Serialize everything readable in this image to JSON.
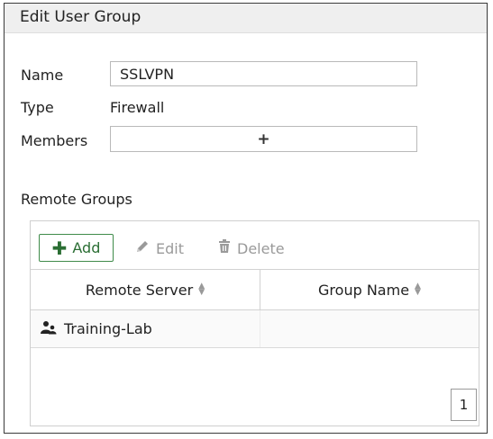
{
  "dialog": {
    "title": "Edit User Group"
  },
  "form": {
    "name_label": "Name",
    "name_value": "SSLVPN",
    "type_label": "Type",
    "type_value": "Firewall",
    "members_label": "Members",
    "members_add_glyph": "+"
  },
  "remote_groups": {
    "label": "Remote Groups",
    "toolbar": {
      "add_label": "Add",
      "edit_label": "Edit",
      "delete_label": "Delete"
    },
    "columns": [
      "Remote Server",
      "Group Name"
    ],
    "rows": [
      {
        "remote_server": "Training-Lab",
        "group_name": "",
        "icon": "user-group-icon"
      }
    ],
    "page": "1"
  },
  "colors": {
    "add_accent": "#3f8b4a",
    "disabled_text": "#9a9a9a",
    "title_bg": "#efefef"
  }
}
